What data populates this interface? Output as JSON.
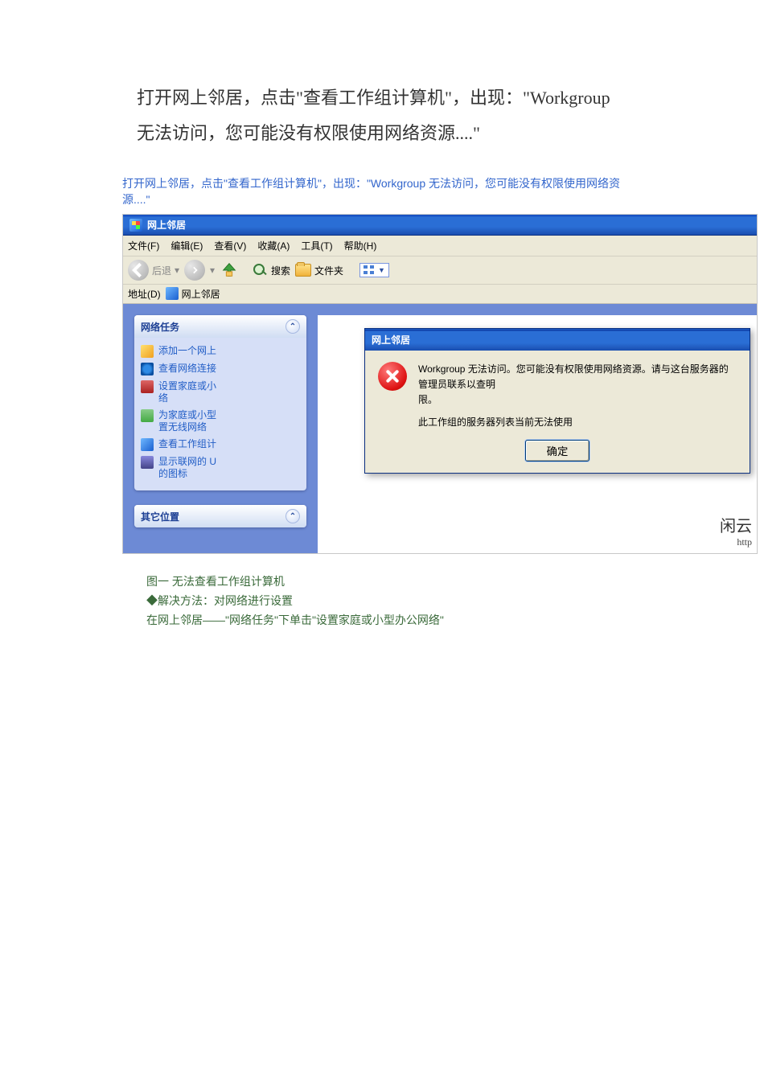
{
  "doc": {
    "heading": "打开网上邻居，点击\"查看工作组计算机\"，出现：\"Workgroup 无法访问，您可能没有权限使用网络资源....\"",
    "caption": "打开网上邻居，点击\"查看工作组计算机\"，出现：\"Workgroup 无法访问，您可能没有权限使用网络资源....\""
  },
  "window": {
    "title": "网上邻居",
    "menus": {
      "file": "文件(F)",
      "edit": "编辑(E)",
      "view": "查看(V)",
      "fav": "收藏(A)",
      "tools": "工具(T)",
      "help": "帮助(H)"
    },
    "toolbar": {
      "back": "后退",
      "search": "搜索",
      "folders": "文件夹"
    },
    "address": {
      "label": "地址(D)",
      "value": "网上邻居"
    }
  },
  "sidebar": {
    "panel1": {
      "title": "网络任务",
      "links": [
        "添加一个网上",
        "查看网络连接",
        "设置家庭或小\n络",
        "为家庭或小型\n置无线网络",
        "查看工作组计",
        "显示联网的 U\n的图标"
      ]
    },
    "panel2": {
      "title": "其它位置"
    }
  },
  "dialog": {
    "title": "网上邻居",
    "msg1": "Workgroup 无法访问。您可能没有权限使用网络资源。请与这台服务器的管理员联系以查明",
    "msg1b": "限。",
    "msg2": "此工作组的服务器列表当前无法使用",
    "ok": "确定"
  },
  "watermark": {
    "line1": "闲云",
    "line2": "http"
  },
  "footer": {
    "fig": "图一   无法查看工作组计算机",
    "solve": "◆解决方法：对网络进行设置",
    "step": "在网上邻居——\"网络任务\"下单击\"设置家庭或小型办公网络\""
  }
}
